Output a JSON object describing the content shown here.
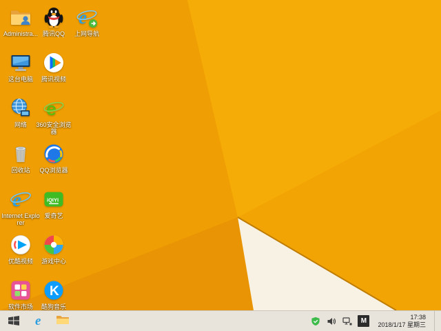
{
  "wallpaper": {
    "colors": {
      "base": "#F6AC06",
      "left": "#EF9E04",
      "bottom_left": "#E99404",
      "right_mid": "#F2A405",
      "white_triangle": "#F7F2E4",
      "edge_line": "#BF7C00"
    }
  },
  "theme": {
    "taskbar_bg": "#E8E4DC",
    "taskbar_border": "#CCC7BE",
    "label_color": "#FFFFFF"
  },
  "desktop": {
    "icons": [
      {
        "label": "Administra..."
      },
      {
        "label": "腾讯QQ"
      },
      {
        "label": "上网导航"
      },
      {
        "label": "这台电脑"
      },
      {
        "label": "腾讯视频"
      },
      {
        "label": "网络"
      },
      {
        "label": "360安全浏览器"
      },
      {
        "label": "回收站"
      },
      {
        "label": "QQ浏览器"
      },
      {
        "label": "Internet Explorer"
      },
      {
        "label": "爱奇艺"
      },
      {
        "label": "优酷视频"
      },
      {
        "label": "游戏中心"
      },
      {
        "label": "软件市场"
      },
      {
        "label": "酷狗音乐"
      }
    ]
  },
  "taskbar": {
    "tray": {
      "time": "17:38",
      "date": "2018/1/17 星期三",
      "input_indicator": "M"
    }
  }
}
